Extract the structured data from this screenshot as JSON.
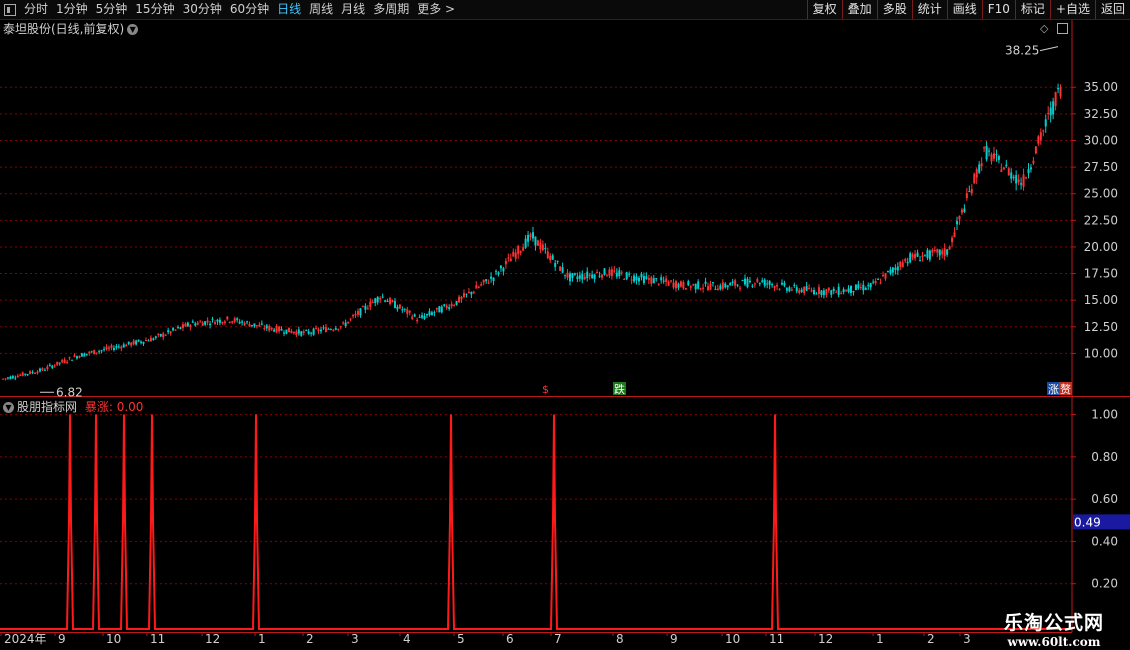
{
  "toolbar": {
    "periods": [
      "分时",
      "1分钟",
      "5分钟",
      "15分钟",
      "30分钟",
      "60分钟",
      "日线",
      "周线",
      "月线",
      "多周期",
      "更多 >"
    ],
    "active_period": "日线",
    "actions": [
      "复权",
      "叠加",
      "多股",
      "统计",
      "画线",
      "F10",
      "标记",
      "+自选",
      "返回"
    ]
  },
  "main_panel": {
    "title": "泰坦股份(日线,前复权)",
    "high_label": "38.25",
    "low_label": "6.82",
    "events": [
      {
        "text": "$",
        "color": "#ff3030",
        "bg": ""
      },
      {
        "text": "跌",
        "color": "#ffffff",
        "bg": "#1a7a1a"
      },
      {
        "text": "涨",
        "color": "#ffffff",
        "bg": "#1a4aa0"
      },
      {
        "text": "赘",
        "color": "#ffffff",
        "bg": "#c03020"
      }
    ]
  },
  "indicator_panel": {
    "title": "股朋指标网",
    "series_label": "暴涨: 0.00",
    "current_value_label": "0.49"
  },
  "x_axis": {
    "labels": [
      "2024年",
      "9",
      "10",
      "11",
      "12",
      "1",
      "2",
      "3",
      "4",
      "5",
      "6",
      "7",
      "8",
      "9",
      "10",
      "11",
      "12",
      "1",
      "2",
      "3"
    ]
  },
  "watermark": {
    "line1": "乐淘公式网",
    "line2": "www.60lt.com"
  },
  "colors": {
    "up": "#ff3232",
    "down": "#00d0d0",
    "grid": "#8b0000",
    "axis": "#c01818",
    "signal": "#ff1a1a"
  },
  "chart_data": [
    {
      "type": "candlestick",
      "title": "泰坦股份(日线,前复权)",
      "ylim": [
        6.0,
        40.0
      ],
      "y_ticks": [
        10.0,
        12.5,
        15.0,
        17.5,
        20.0,
        22.5,
        25.0,
        27.5,
        30.0,
        32.5,
        35.0
      ],
      "annotations": [
        {
          "text": "38.25",
          "value": 38.25,
          "kind": "high"
        },
        {
          "text": "6.82",
          "value": 6.82,
          "kind": "low"
        }
      ],
      "x": [
        "2024-08",
        "2024-09",
        "2024-10",
        "2024-11",
        "2024-12",
        "2025-01",
        "2025-02",
        "2025-03",
        "2025-04",
        "2025-05",
        "2025-06",
        "2025-07",
        "2025-08",
        "2025-09",
        "2025-10",
        "2025-11",
        "2025-12",
        "2026-01",
        "2026-02",
        "2026-03"
      ],
      "close": [
        7.6,
        8.4,
        9.8,
        10.6,
        11.4,
        12.8,
        13.2,
        12.4,
        11.9,
        12.6,
        15.4,
        13.2,
        14.8,
        17.2,
        21.0,
        17.1,
        17.6,
        17.0,
        16.4,
        16.3,
        16.8,
        16.0,
        15.8,
        16.3,
        19.0,
        19.5,
        29.0,
        26.0,
        35.0
      ]
    },
    {
      "type": "line",
      "title": "股朋指标网",
      "series": [
        {
          "name": "暴涨",
          "values": [
            0,
            0,
            1,
            0,
            1,
            0,
            1,
            0,
            1,
            0,
            1,
            0,
            1,
            0,
            1,
            0,
            1,
            0,
            1,
            0
          ]
        }
      ],
      "ylim": [
        0.0,
        1.05
      ],
      "y_ticks": [
        0.2,
        0.4,
        0.6,
        0.8,
        1.0
      ],
      "current_value": 0.49
    }
  ]
}
